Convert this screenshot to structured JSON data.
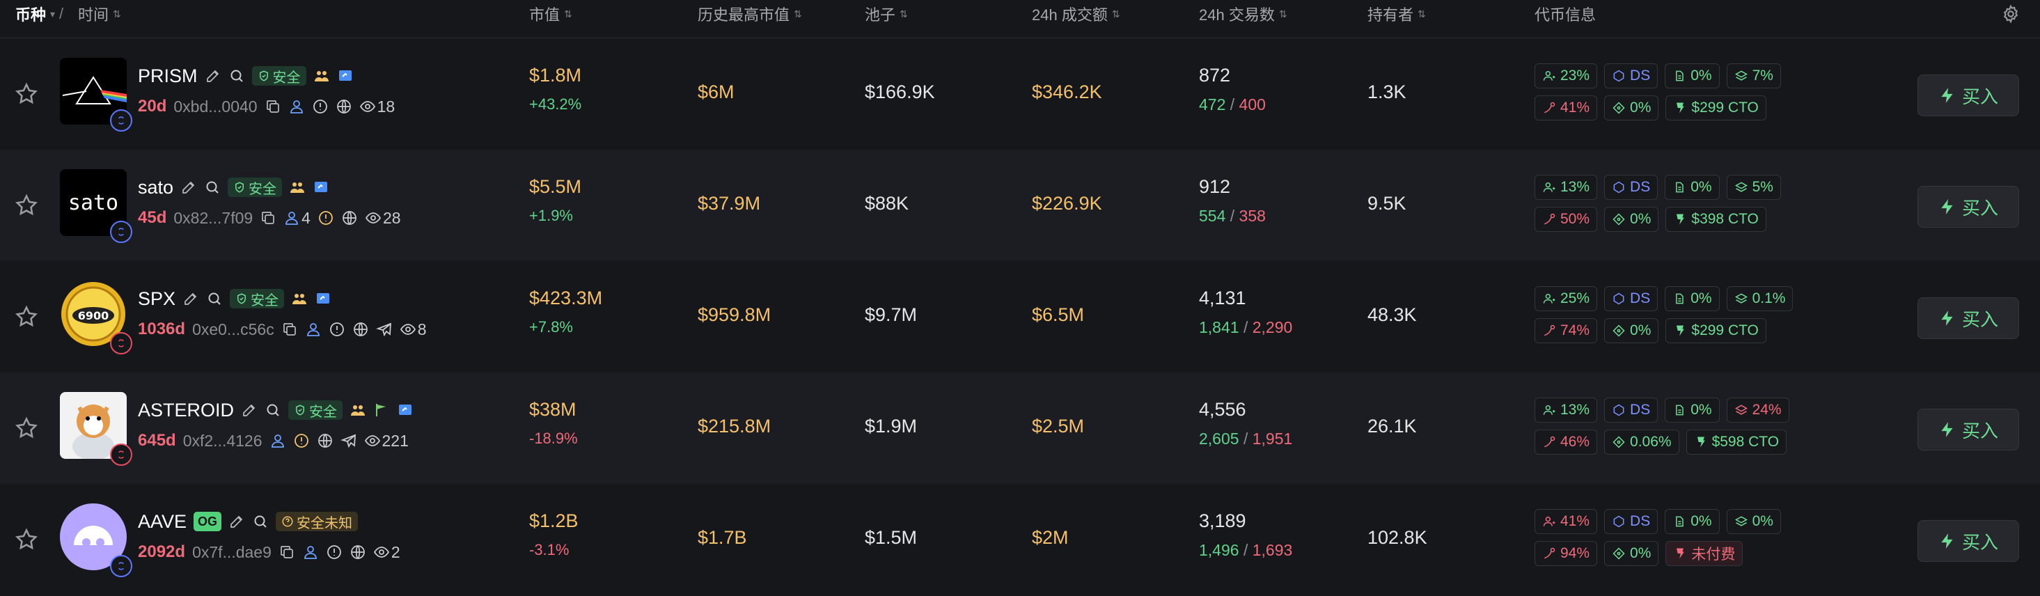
{
  "header": {
    "coin_label": "币种",
    "time_label": "时间",
    "sep": "/",
    "columns": [
      "市值",
      "历史最高市值",
      "池子",
      "24h 成交额",
      "24h 交易数",
      "持有者",
      "代币信息"
    ]
  },
  "colors": {
    "safe": "#6fdc93",
    "danger": "#f06a7a",
    "accent_yellow": "#f5c06a",
    "blue": "#6ea0ff"
  },
  "rows": [
    {
      "name": "PRISM",
      "tag": "安全",
      "tag_type": "safe",
      "age": "20d",
      "addr": "0xbd...0040",
      "holders_icon_count": "",
      "views": "18",
      "mcap": "$1.8M",
      "mcap_chg": "+43.2%",
      "chg_dir": "up",
      "ath": "$6M",
      "pool": "$166.9K",
      "vol": "$346.2K",
      "tx": "872",
      "buys": "472",
      "sells": "400",
      "holders": "1.3K",
      "chips": {
        "top10": "23%",
        "dev": "0%",
        "lp": "7%",
        "sniper": "41%",
        "insider": "0%",
        "cto": "$299 CTO"
      },
      "chip_flags": {
        "top10": "g",
        "lp": "g",
        "sniper": "r",
        "cto": "g"
      },
      "avatar": "prism",
      "chain": "blue",
      "icons": [
        "edit",
        "search",
        "safe",
        "people",
        "chat-blue"
      ],
      "sub_icons": [
        "copy",
        "user-blue",
        "alert",
        "globe",
        "eye"
      ]
    },
    {
      "name": "sato",
      "tag": "安全",
      "tag_type": "safe",
      "age": "45d",
      "addr": "0x82...7f09",
      "holders_icon_count": "4",
      "views": "28",
      "mcap": "$5.5M",
      "mcap_chg": "+1.9%",
      "chg_dir": "up",
      "ath": "$37.9M",
      "pool": "$88K",
      "vol": "$226.9K",
      "tx": "912",
      "buys": "554",
      "sells": "358",
      "holders": "9.5K",
      "chips": {
        "top10": "13%",
        "dev": "0%",
        "lp": "5%",
        "sniper": "50%",
        "insider": "0%",
        "cto": "$398 CTO"
      },
      "chip_flags": {
        "top10": "g",
        "lp": "g",
        "sniper": "r",
        "cto": "g"
      },
      "avatar": "sato",
      "chain": "blue",
      "icons": [
        "edit",
        "search",
        "safe",
        "people",
        "chat-blue"
      ],
      "sub_icons": [
        "copy",
        "user-blue",
        "alert-yellow",
        "globe",
        "eye"
      ]
    },
    {
      "name": "SPX",
      "tag": "安全",
      "tag_type": "safe",
      "age": "1036d",
      "addr": "0xe0...c56c",
      "holders_icon_count": "",
      "views": "8",
      "mcap": "$423.3M",
      "mcap_chg": "+7.8%",
      "chg_dir": "up",
      "ath": "$959.8M",
      "pool": "$9.7M",
      "vol": "$6.5M",
      "tx": "4,131",
      "buys": "1,841",
      "sells": "2,290",
      "holders": "48.3K",
      "chips": {
        "top10": "25%",
        "dev": "0%",
        "lp": "0.1%",
        "sniper": "74%",
        "insider": "0%",
        "cto": "$299 CTO"
      },
      "chip_flags": {
        "top10": "g",
        "lp": "g",
        "sniper": "r",
        "cto": "g"
      },
      "avatar": "spx",
      "chain": "red",
      "icons": [
        "edit",
        "search",
        "safe",
        "people",
        "chat-blue"
      ],
      "sub_icons": [
        "copy",
        "user-blue",
        "alert",
        "globe",
        "telegram",
        "eye"
      ]
    },
    {
      "name": "ASTEROID",
      "tag": "安全",
      "tag_type": "safe",
      "age": "645d",
      "addr": "0xf2...4126",
      "holders_icon_count": "",
      "views": "221",
      "mcap": "$38M",
      "mcap_chg": "-18.9%",
      "chg_dir": "down",
      "ath": "$215.8M",
      "pool": "$1.9M",
      "vol": "$2.5M",
      "tx": "4,556",
      "buys": "2,605",
      "sells": "1,951",
      "holders": "26.1K",
      "chips": {
        "top10": "13%",
        "dev": "0%",
        "lp": "24%",
        "sniper": "46%",
        "insider": "0.06%",
        "cto": "$598 CTO"
      },
      "chip_flags": {
        "top10": "g",
        "lp": "r",
        "sniper": "r",
        "cto": "g"
      },
      "avatar": "asteroid",
      "chain": "red",
      "icons": [
        "edit",
        "search",
        "safe",
        "people",
        "flag",
        "chat-blue"
      ],
      "sub_icons": [
        "user-blue",
        "alert-yellow",
        "globe",
        "telegram",
        "eye"
      ]
    },
    {
      "name": "AAVE",
      "tag": "安全未知",
      "tag_type": "unknown",
      "og": "OG",
      "age": "2092d",
      "addr": "0x7f...dae9",
      "holders_icon_count": "",
      "views": "2",
      "mcap": "$1.2B",
      "mcap_chg": "-3.1%",
      "chg_dir": "down",
      "ath": "$1.7B",
      "pool": "$1.5M",
      "vol": "$2M",
      "tx": "3,189",
      "buys": "1,496",
      "sells": "1,693",
      "holders": "102.8K",
      "chips": {
        "top10": "41%",
        "dev": "0%",
        "lp": "0%",
        "sniper": "94%",
        "insider": "0%",
        "cto": "未付费"
      },
      "chip_flags": {
        "top10": "r",
        "lp": "g",
        "sniper": "r",
        "cto": "r"
      },
      "avatar": "aave",
      "chain": "blue",
      "icons": [
        "og",
        "edit",
        "search",
        "unknown"
      ],
      "sub_icons": [
        "copy",
        "user-blue",
        "alert",
        "globe",
        "eye"
      ]
    }
  ],
  "buy_label": "买入",
  "ds_label": "DS"
}
